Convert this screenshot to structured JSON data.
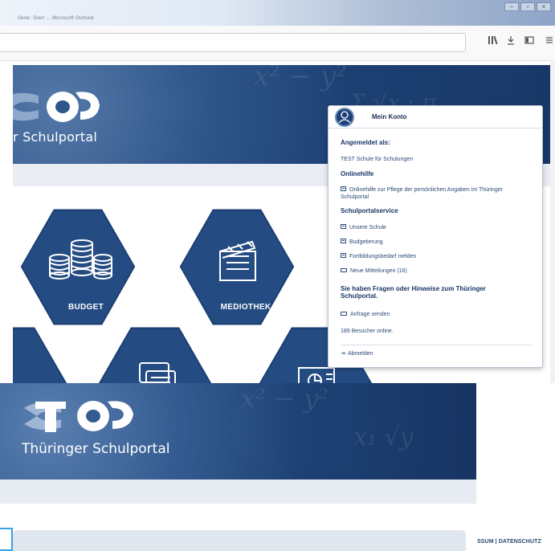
{
  "window": {
    "blurred_tab_text": "Seite: Start ... Microsoft Outlook",
    "controls": [
      "minimize-icon",
      "restore-icon",
      "close-icon"
    ]
  },
  "toolbar": {
    "icons": [
      "library-icon",
      "download-icon",
      "sidebar-icon",
      "menu-icon"
    ]
  },
  "banner": {
    "portal_title": "r Schulportal"
  },
  "tiles": [
    {
      "label": "BUDGET",
      "icon": "coins-icon"
    },
    {
      "label": "MEDIOTHEK",
      "icon": "clapperboard-icon"
    },
    {
      "label": "",
      "icon": "document-icon"
    },
    {
      "label": "",
      "icon": "messages-icon"
    },
    {
      "label": "",
      "icon": "presentation-chart-icon"
    }
  ],
  "account_menu": {
    "header_title": "Mein Konto",
    "logged_in_heading": "Angemeldet als:",
    "logged_in_user": "TEST Schule für Schulungen",
    "help_heading": "Onlinehilfe",
    "help_link": "Onlinehilfe zur Pflege der persönlichen Angaben im Thüringer Schulportal",
    "service_heading": "Schulportalservice",
    "service_links": [
      "Unsere Schule",
      "Budgetierung",
      "Fortbildungsbedarf melden",
      "Neue Mitteilungen (16)"
    ],
    "questions_heading": "Sie haben Fragen oder Hinweise zum Thüringer Schulportal.",
    "request_link": "Anfrage senden",
    "visitors": "189 Besucher online.",
    "logout": "Abmelden"
  },
  "lower": {
    "portal_title": "Thüringer Schulportal",
    "footer_links": "SSUM | DATENSCHUTZ"
  },
  "colors": {
    "banner_dark": "#183867",
    "banner_light": "#5478a8",
    "menu_text": "#2b4a7a",
    "accent_select": "#34a4e8"
  }
}
